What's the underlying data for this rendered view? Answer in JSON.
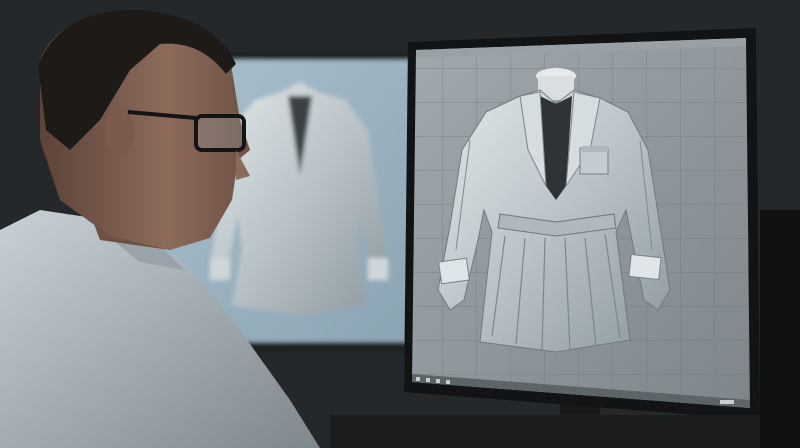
{
  "scene": {
    "palette": {
      "background": "#24272a",
      "left_screen": "#9fb6c4",
      "right_screen_grid": "#8e959b",
      "garment": "#c9d2d6",
      "shirt": "#d8dfe3"
    },
    "objects": [
      "man-with-glasses",
      "left-monitor",
      "right-monitor",
      "3d-jacket-model",
      "grid-viewport"
    ]
  }
}
